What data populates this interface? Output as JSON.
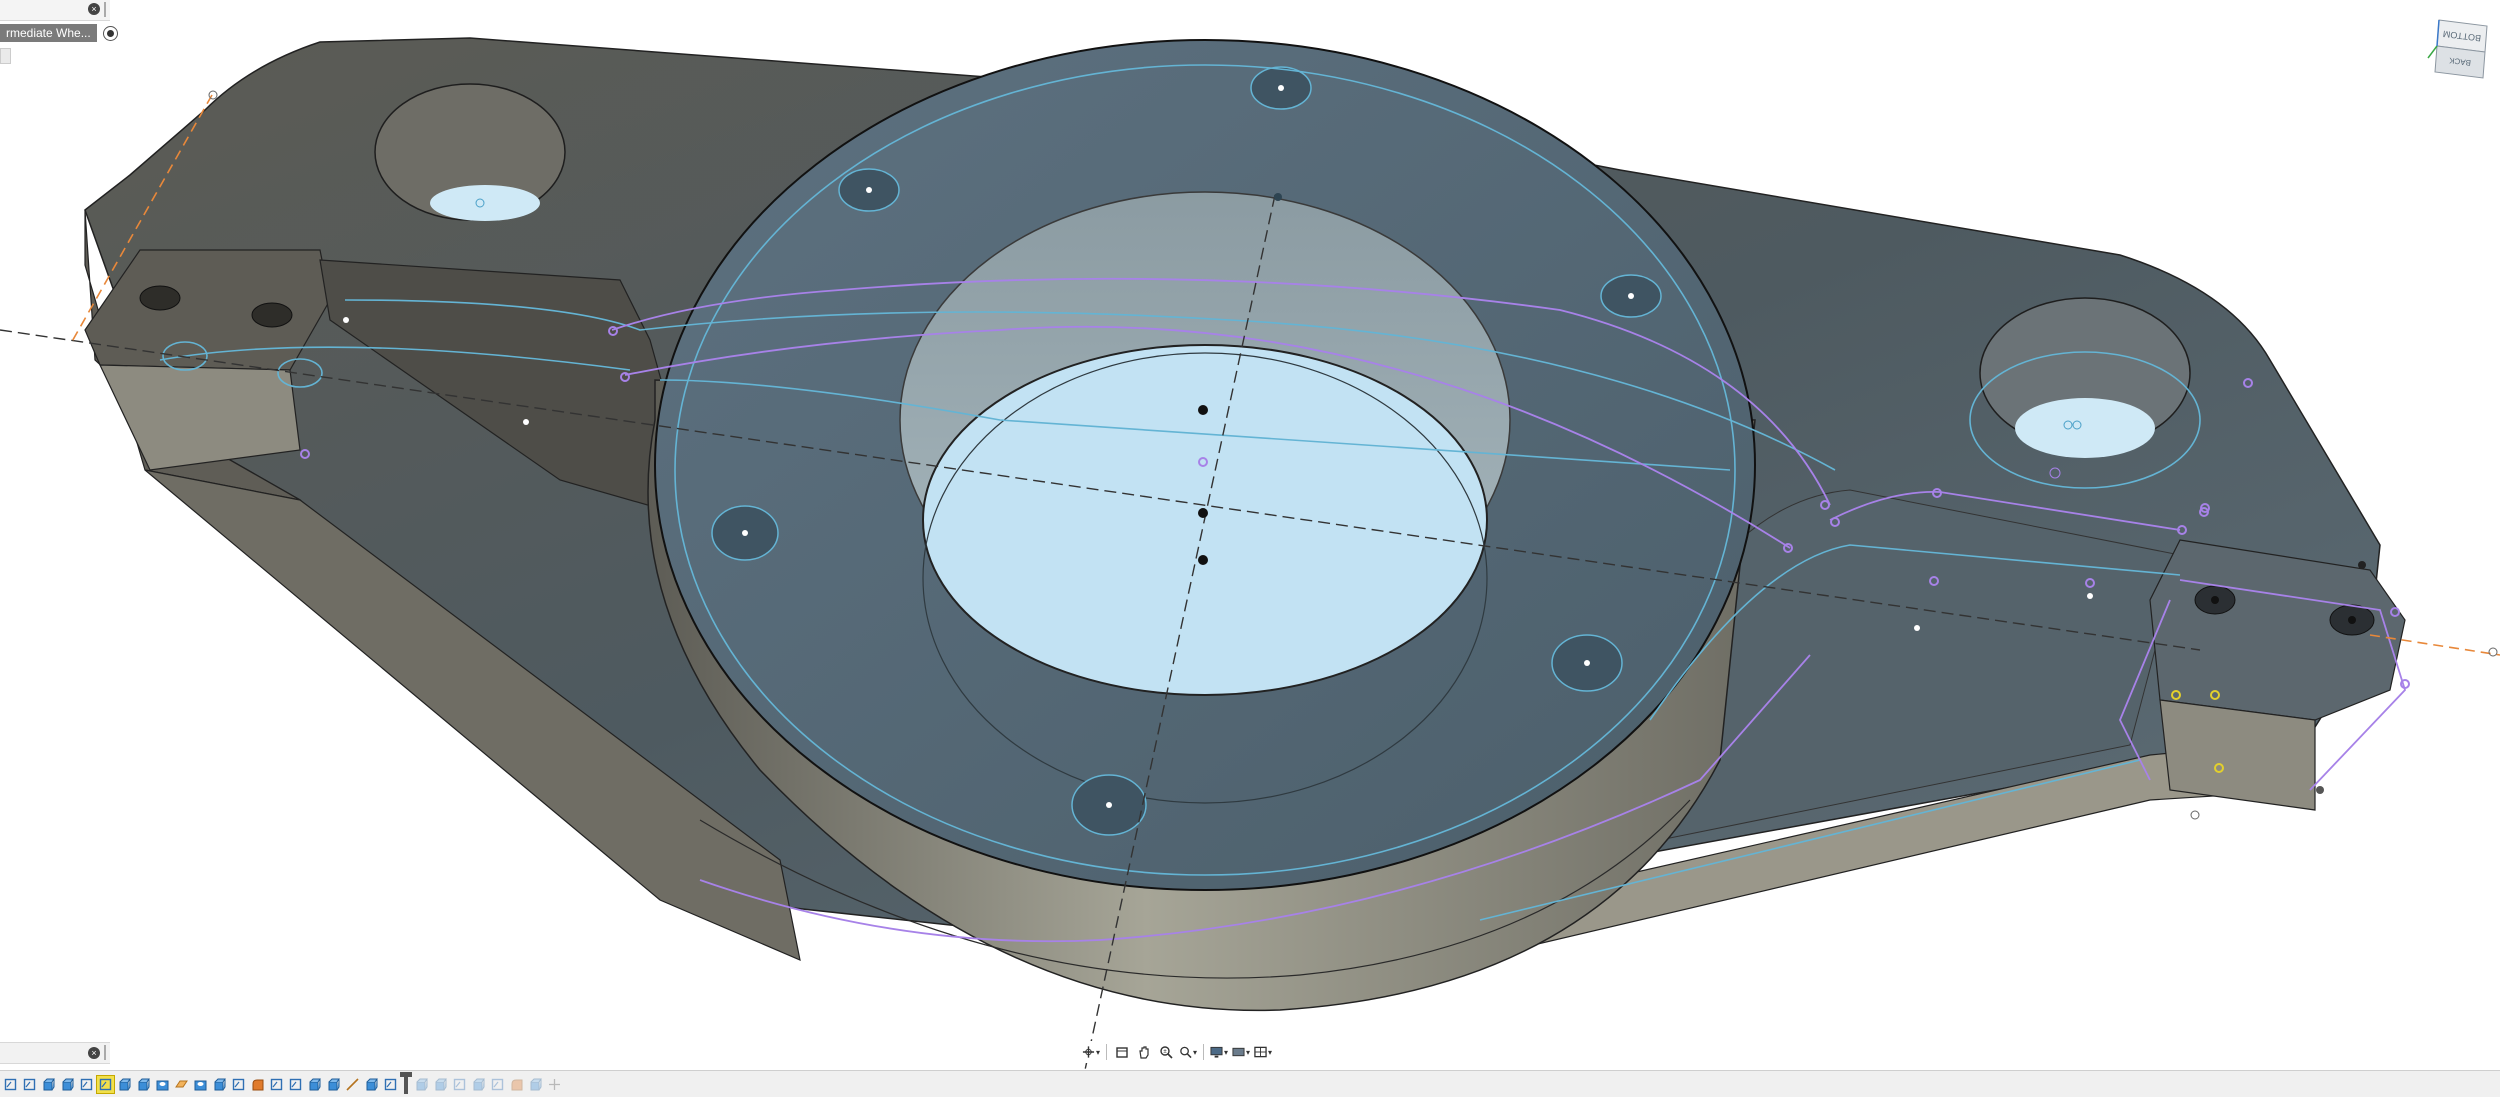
{
  "browser": {
    "component_label": "rmediate Whe...",
    "close_glyph": "×"
  },
  "comments": {
    "close_glyph": "×"
  },
  "viewcube": {
    "faces": [
      "BOTTOM",
      "BACK"
    ]
  },
  "navbar": {
    "tools": [
      "orbit-icon",
      "look-at-icon",
      "pan-icon",
      "zoom-icon",
      "fit-icon",
      "display-settings-icon",
      "grid-settings-icon",
      "viewports-icon"
    ]
  },
  "timeline": {
    "items": [
      {
        "icon": "sketch-icon",
        "state": "normal"
      },
      {
        "icon": "sketch-icon",
        "state": "normal"
      },
      {
        "icon": "extrude-icon",
        "state": "normal"
      },
      {
        "icon": "extrude-icon",
        "state": "normal"
      },
      {
        "icon": "sketch-icon",
        "state": "normal"
      },
      {
        "icon": "sketch-icon",
        "state": "active"
      },
      {
        "icon": "extrude-icon",
        "state": "normal"
      },
      {
        "icon": "extrude-icon",
        "state": "normal"
      },
      {
        "icon": "hole-icon",
        "state": "normal"
      },
      {
        "icon": "construction-plane-icon",
        "state": "normal"
      },
      {
        "icon": "hole-icon",
        "state": "normal"
      },
      {
        "icon": "extrude-icon",
        "state": "normal"
      },
      {
        "icon": "sketch-icon",
        "state": "normal"
      },
      {
        "icon": "fillet-icon",
        "state": "normal"
      },
      {
        "icon": "sketch-icon",
        "state": "normal"
      },
      {
        "icon": "sketch-icon",
        "state": "normal"
      },
      {
        "icon": "extrude-icon",
        "state": "normal"
      },
      {
        "icon": "extrude-icon",
        "state": "normal"
      },
      {
        "icon": "construction-axis-icon",
        "state": "normal"
      },
      {
        "icon": "extrude-icon",
        "state": "normal"
      },
      {
        "icon": "sketch-icon",
        "state": "normal"
      },
      {
        "icon": "marker",
        "state": "marker"
      },
      {
        "icon": "extrude-icon",
        "state": "muted"
      },
      {
        "icon": "extrude-icon",
        "state": "muted"
      },
      {
        "icon": "sketch-icon",
        "state": "muted"
      },
      {
        "icon": "extrude-icon",
        "state": "muted"
      },
      {
        "icon": "sketch-icon",
        "state": "muted"
      },
      {
        "icon": "fillet-icon",
        "state": "muted"
      },
      {
        "icon": "extrude-icon",
        "state": "muted"
      },
      {
        "icon": "move-icon",
        "state": "muted"
      }
    ]
  },
  "colors": {
    "body_side": "#8a877b",
    "body_top": "#4f5d63",
    "disc_top": "#596d78",
    "hole_floor": "#c2e2f3",
    "sketch_blue": "#64b4d4",
    "sketch_purple": "#a782e8",
    "axis_orange": "#e8883a",
    "timeline_active": "#f2e04a"
  }
}
